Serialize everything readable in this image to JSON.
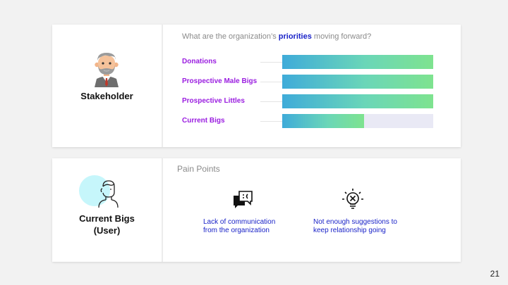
{
  "stakeholder": {
    "name": "Stakeholder",
    "question_prefix": "What are the organization’s ",
    "question_highlight": "priorities",
    "question_suffix": " moving forward?",
    "priorities": [
      {
        "label": "Donations",
        "level": 1.0
      },
      {
        "label": "Prospective Male Bigs",
        "level": 1.0
      },
      {
        "label": "Prospective Littles",
        "level": 1.0
      },
      {
        "label": "Current Bigs",
        "level": 0.54
      }
    ]
  },
  "user": {
    "name_line1": "Current Bigs",
    "name_line2": "(User)",
    "pain_title": "Pain Points",
    "pain_points": [
      {
        "icon": "chat-frown-icon",
        "line1": "Lack of communication",
        "line2": "from the organization"
      },
      {
        "icon": "lightbulb-x-icon",
        "line1": "Not enough suggestions to",
        "line2": "keep relationship going"
      }
    ]
  },
  "page_number": "21",
  "colors": {
    "highlight": "#1a23c8",
    "label": "#9a1de0",
    "bar_start": "#3fabd9",
    "bar_end": "#7ee38f",
    "track": "#e9e9f5"
  }
}
